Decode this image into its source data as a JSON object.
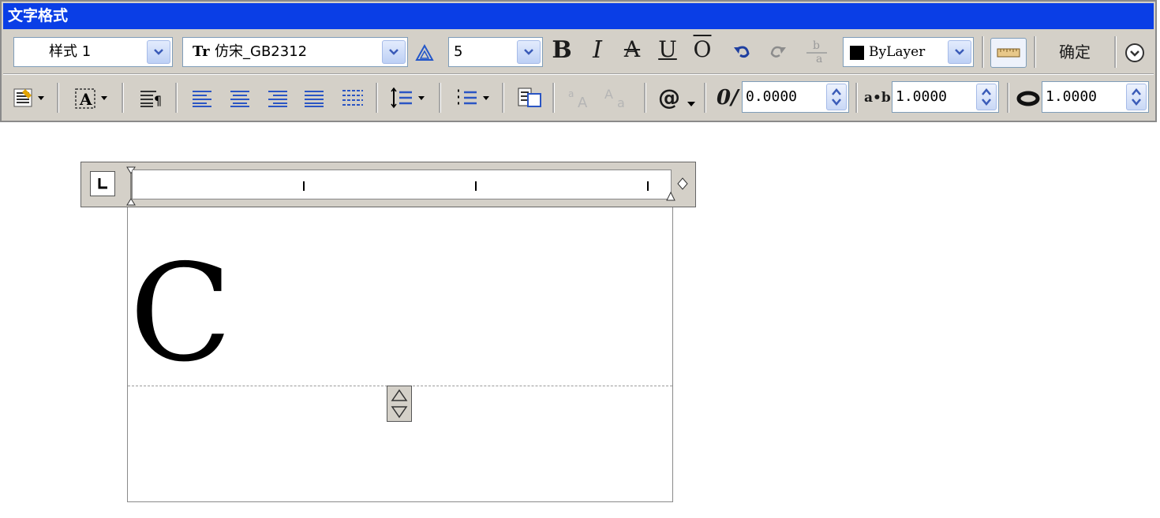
{
  "window": {
    "title": "文字格式"
  },
  "toolbar": {
    "style_value": "样式 1",
    "font_value": "仿宋_GB2312",
    "font_icon": "Tr",
    "height_value": "5",
    "bold": "B",
    "italic": "I",
    "strike": "A",
    "underline": "U",
    "overline": "O",
    "color_value": "ByLayer",
    "color_swatch": "#000000",
    "ok_label": "确定"
  },
  "format": {
    "oblique_value": "0.0000",
    "tracking_value": "1.0000",
    "width_value": "1.0000",
    "at_symbol": "@",
    "oblique_symbol": "0/",
    "tracking_symbol": "a•b"
  },
  "editor": {
    "content": "C"
  },
  "colors": {
    "titlebar": "#0a3ee6",
    "toolbar_bg": "#d4d0c8"
  }
}
